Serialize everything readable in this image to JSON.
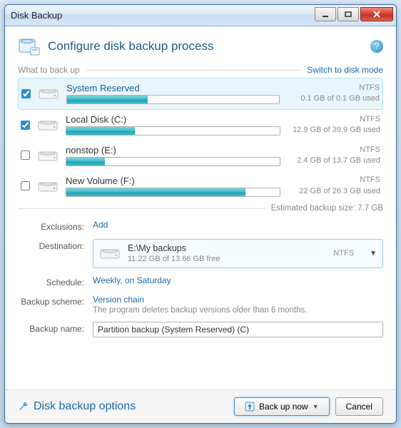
{
  "window": {
    "title": "Disk Backup"
  },
  "header": {
    "title": "Configure disk backup process"
  },
  "section": {
    "label": "What to back up",
    "switch_link": "Switch to disk mode"
  },
  "volumes": [
    {
      "name": "System Reserved",
      "fs": "NTFS",
      "usage": "0.1 GB of 0.1 GB used",
      "fill": 38,
      "checked": true,
      "selected": true
    },
    {
      "name": "Local Disk (C:)",
      "fs": "NTFS",
      "usage": "12.9 GB of 39.9 GB used",
      "fill": 32,
      "checked": true,
      "selected": false
    },
    {
      "name": "nonstop (E:)",
      "fs": "NTFS",
      "usage": "2.4 GB of 13.7 GB used",
      "fill": 18,
      "checked": false,
      "selected": false
    },
    {
      "name": "New Volume (F:)",
      "fs": "NTFS",
      "usage": "22 GB of 26.3 GB used",
      "fill": 84,
      "checked": false,
      "selected": false
    }
  ],
  "estimate": "Estimated backup size:  7.7 GB",
  "form": {
    "exclusions_label": "Exclusions:",
    "exclusions_link": "Add",
    "destination_label": "Destination:",
    "destination_path": "E:\\My backups",
    "destination_sub": "11.22 GB of 13.66 GB free",
    "destination_fs": "NTFS",
    "schedule_label": "Schedule:",
    "schedule_link": "Weekly, on Saturday",
    "scheme_label": "Backup scheme:",
    "scheme_link": "Version chain",
    "scheme_note": "The program deletes backup versions older than 6 months.",
    "name_label": "Backup name:",
    "name_value": "Partition backup (System Reserved) (C)"
  },
  "footer": {
    "options_link": "Disk backup options",
    "backup_btn": "Back up now",
    "cancel_btn": "Cancel"
  }
}
